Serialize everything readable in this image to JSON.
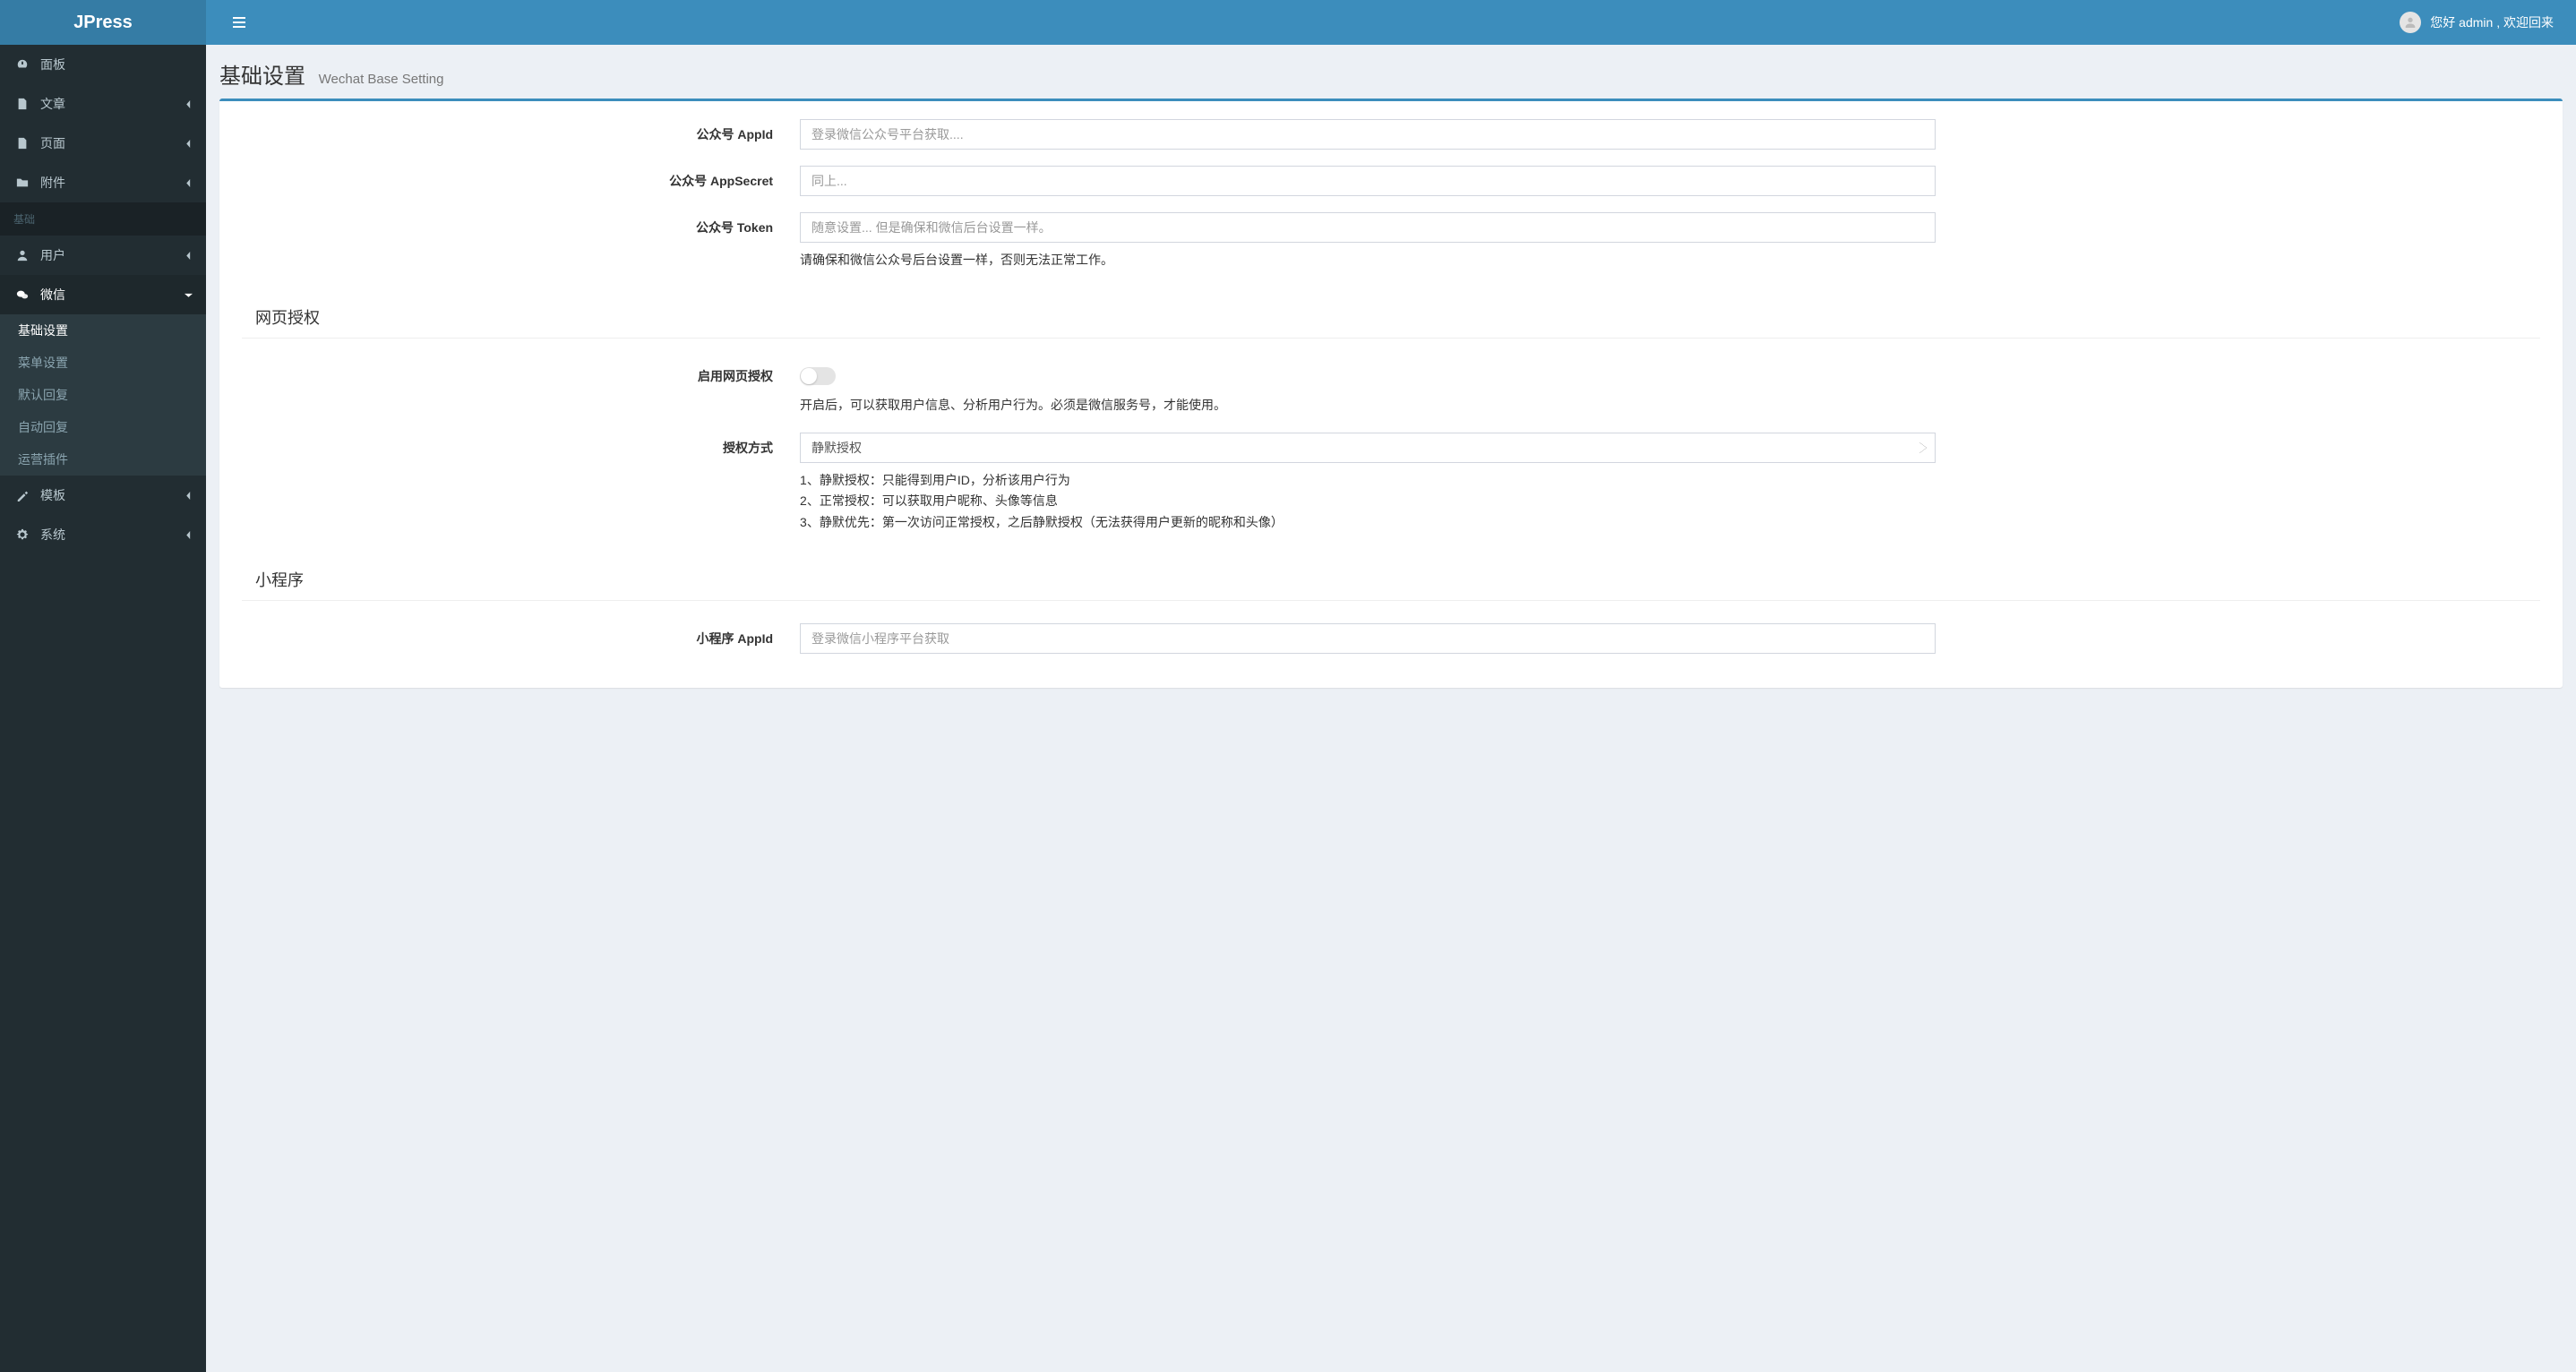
{
  "brand": "JPress",
  "greeting": "您好 admin , 欢迎回来",
  "sidebar": {
    "dashboard": "面板",
    "article": "文章",
    "page": "页面",
    "attachment": "附件",
    "section_base": "基础",
    "user": "用户",
    "wechat": "微信",
    "wechat_sub": {
      "base": "基础设置",
      "menu": "菜单设置",
      "default_reply": "默认回复",
      "auto_reply": "自动回复",
      "plugin": "运营插件"
    },
    "template": "模板",
    "system": "系统"
  },
  "page_header": {
    "title": "基础设置",
    "subtitle": "Wechat Base Setting"
  },
  "form": {
    "appid_label": "公众号 AppId",
    "appid_placeholder": "登录微信公众号平台获取....",
    "appsecret_label": "公众号 AppSecret",
    "appsecret_placeholder": "同上...",
    "token_label": "公众号 Token",
    "token_placeholder": "随意设置... 但是确保和微信后台设置一样。",
    "token_help": "请确保和微信公众号后台设置一样，否则无法正常工作。",
    "section_web_auth": "网页授权",
    "enable_web_auth_label": "启用网页授权",
    "enable_web_auth_help": "开启后，可以获取用户信息、分析用户行为。必须是微信服务号，才能使用。",
    "auth_mode_label": "授权方式",
    "auth_mode_selected": "静默授权",
    "auth_mode_help_1": "1、静默授权：只能得到用户ID，分析该用户行为",
    "auth_mode_help_2": "2、正常授权：可以获取用户昵称、头像等信息",
    "auth_mode_help_3": "3、静默优先：第一次访问正常授权，之后静默授权（无法获得用户更新的昵称和头像）",
    "section_miniprogram": "小程序",
    "mp_appid_label": "小程序 AppId",
    "mp_appid_placeholder": "登录微信小程序平台获取"
  }
}
